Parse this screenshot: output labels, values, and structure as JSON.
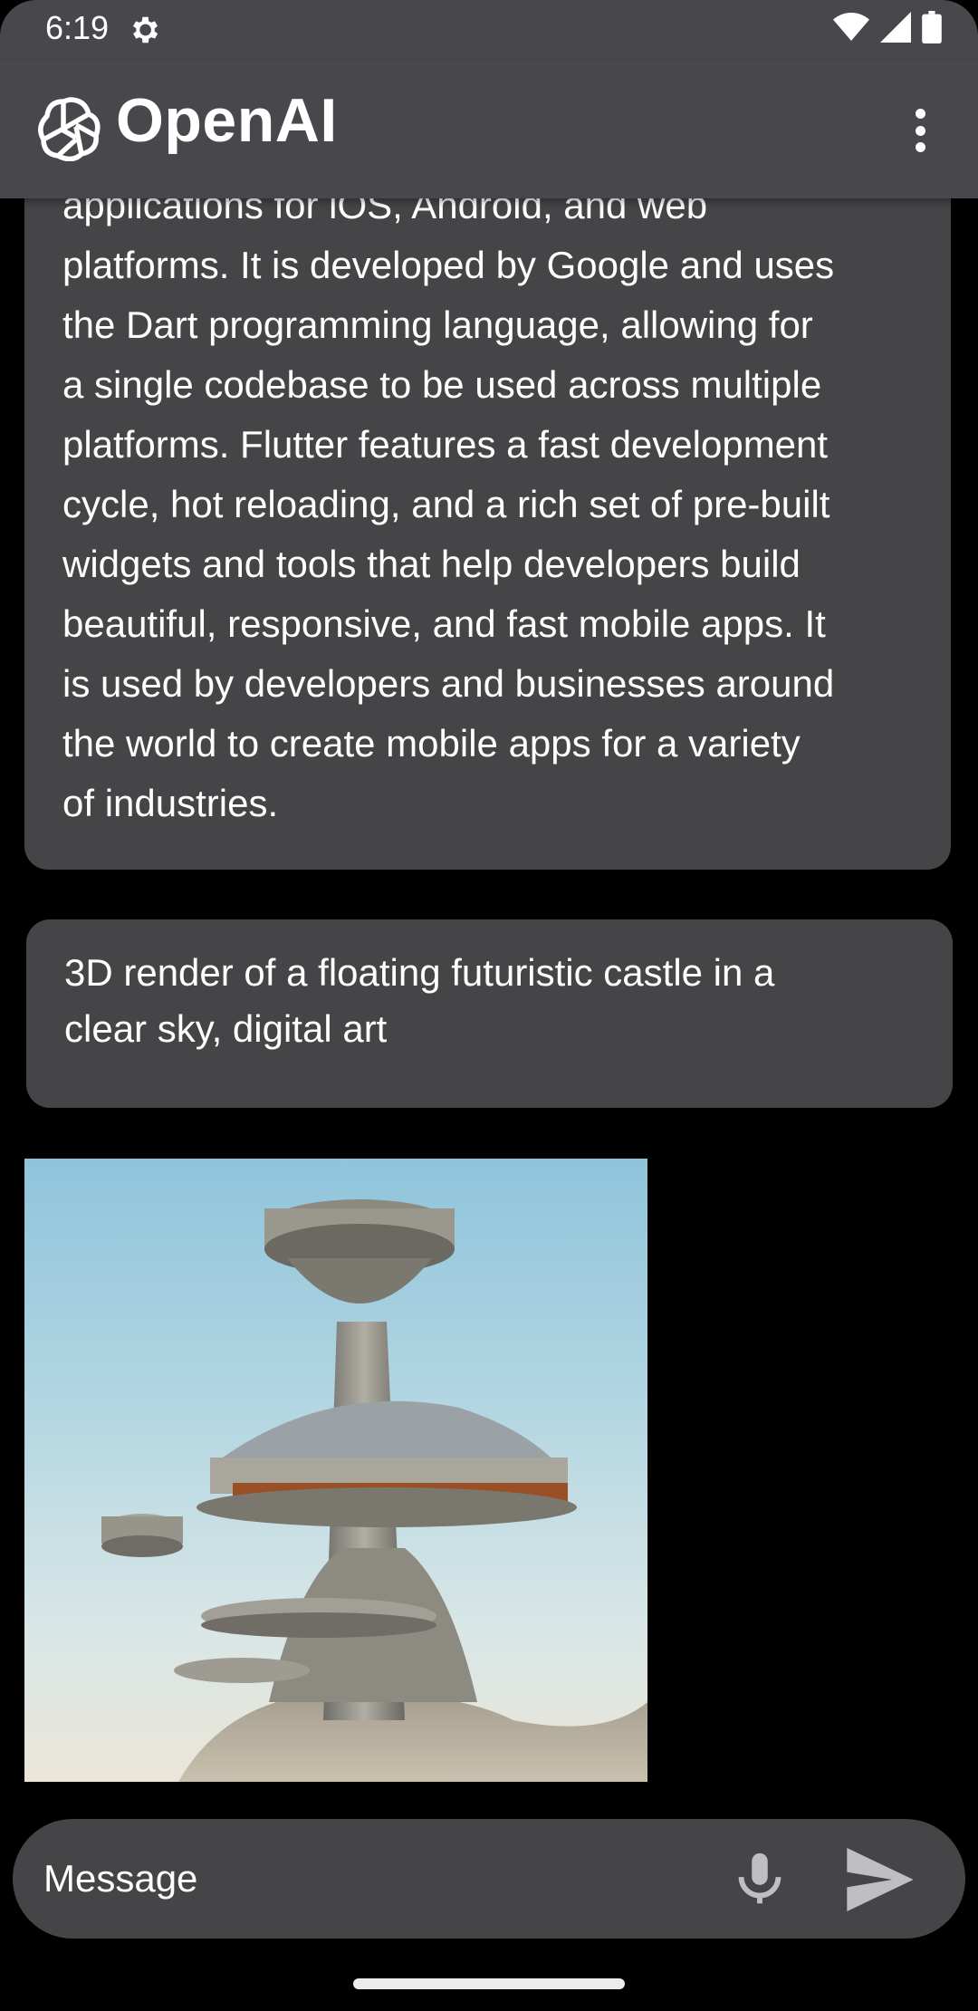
{
  "status_bar": {
    "time": "6:19"
  },
  "app_bar": {
    "title": "OpenAI"
  },
  "messages": {
    "bot_response_lines": [
      "applications for iOS, Android, and web",
      "platforms. It is developed by Google and uses",
      "the Dart programming language, allowing for",
      "a single codebase to be used across multiple",
      "platforms. Flutter features a fast development",
      "cycle, hot reloading, and a rich set of pre-built",
      "widgets and tools that help developers build",
      "beautiful, responsive, and fast mobile apps. It",
      "is used by developers and businesses around",
      "the world to create mobile apps for a variety",
      "of industries."
    ],
    "user_prompt_lines": [
      "3D render of a floating futuristic castle in a",
      "clear sky, digital art"
    ]
  },
  "composer": {
    "placeholder": "Message"
  },
  "icons": {
    "status": [
      "gear-icon",
      "wifi-icon",
      "signal-icon",
      "battery-icon"
    ],
    "app_bar": [
      "openai-logo-icon",
      "more-vert-icon"
    ],
    "composer": [
      "mic-icon",
      "send-icon"
    ]
  },
  "colors": {
    "background": "#000000",
    "bar": "#48484c",
    "bubble": "#454547",
    "text": "#ffffff"
  }
}
